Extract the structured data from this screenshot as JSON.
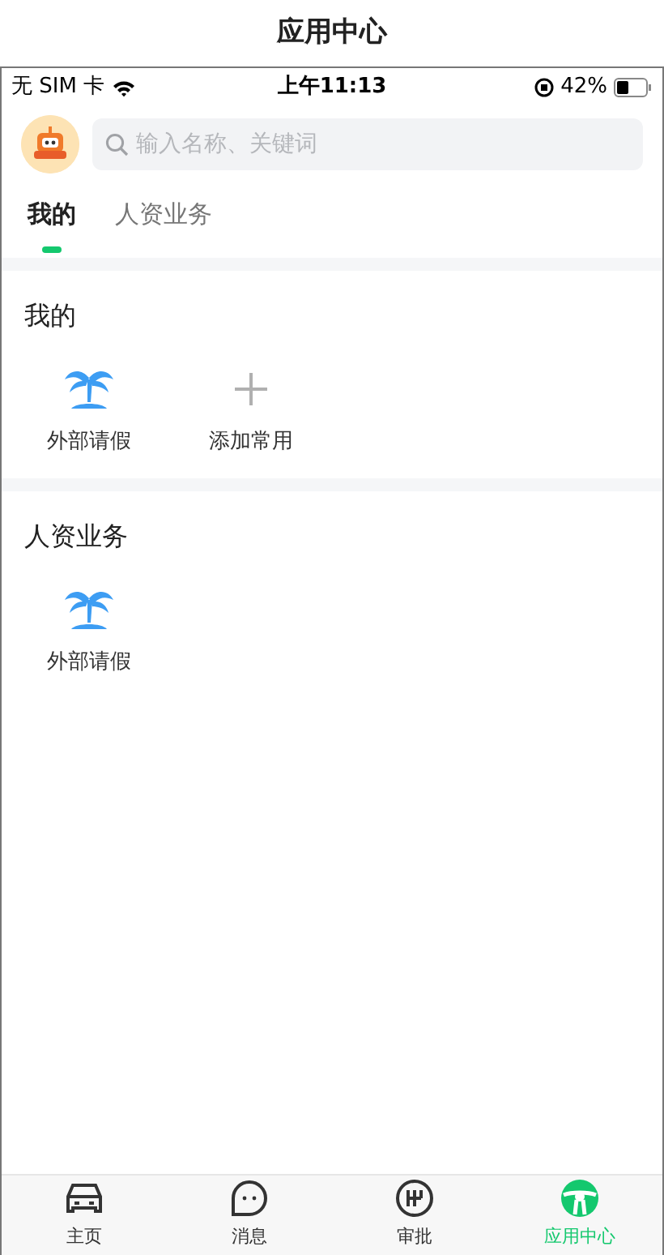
{
  "page_title": "应用中心",
  "status_bar": {
    "carrier": "无 SIM 卡",
    "time": "上午11:13",
    "battery": "42%"
  },
  "search": {
    "placeholder": "输入名称、关键词"
  },
  "tabs": [
    {
      "label": "我的",
      "selected": true
    },
    {
      "label": "人资业务",
      "selected": false
    }
  ],
  "sections": [
    {
      "title": "我的",
      "items": [
        {
          "kind": "app",
          "label": "外部请假"
        },
        {
          "kind": "add",
          "label": "添加常用"
        }
      ]
    },
    {
      "title": "人资业务",
      "items": [
        {
          "kind": "app",
          "label": "外部请假"
        }
      ]
    }
  ],
  "bottom_nav": [
    {
      "kind": "car",
      "label": "主页",
      "selected": false
    },
    {
      "kind": "chat",
      "label": "消息",
      "selected": false
    },
    {
      "kind": "gear",
      "label": "审批",
      "selected": false
    },
    {
      "kind": "wheel",
      "label": "应用中心",
      "selected": true
    }
  ]
}
